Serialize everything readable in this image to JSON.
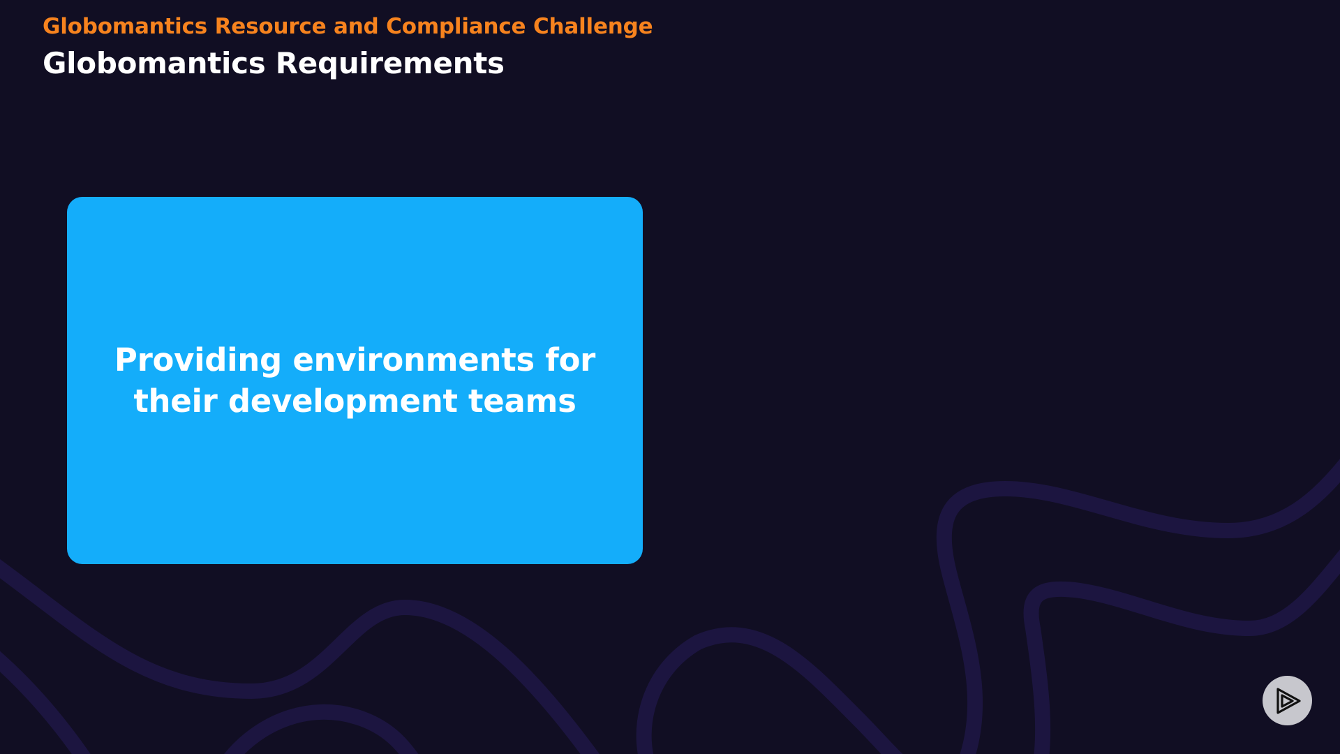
{
  "slide": {
    "kicker": "Globomantics Resource and Compliance Challenge",
    "title": "Globomantics Requirements",
    "card": {
      "text": "Providing environments for their development teams",
      "color": "#14adfa"
    },
    "accent_color": "#f7831e",
    "background_color": "#110e23"
  },
  "player": {
    "icon": "pluralsight-play-icon"
  }
}
